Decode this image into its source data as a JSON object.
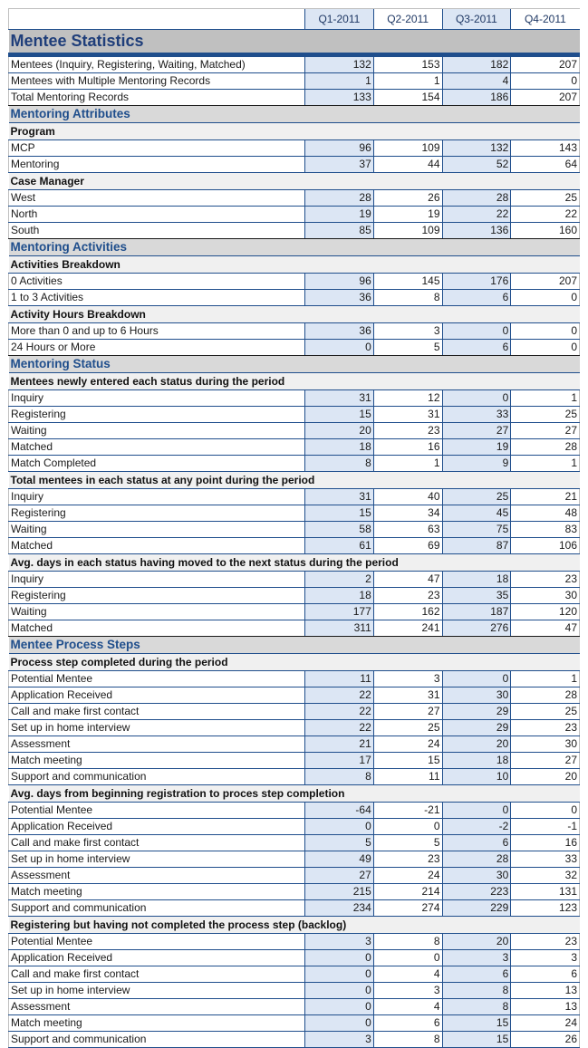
{
  "columns": [
    "Q1-2011",
    "Q2-2011",
    "Q3-2011",
    "Q4-2011"
  ],
  "title": "Mentee Statistics",
  "colors": {
    "title_text": "#1f3e7a",
    "accent_rule": "#1f4e8c",
    "shaded_column": "#dce6f4",
    "title_band": "#c0c0c0",
    "section_band": "#d9d9d9",
    "group_band": "#f0f0f0"
  },
  "top_rows": [
    {
      "label": "Mentees (Inquiry, Registering, Waiting, Matched)",
      "values": [
        132,
        153,
        182,
        207
      ]
    },
    {
      "label": "Mentees with Multiple Mentoring Records",
      "values": [
        1,
        1,
        4,
        0
      ]
    },
    {
      "label": "Total Mentoring Records",
      "values": [
        133,
        154,
        186,
        207
      ]
    }
  ],
  "sections": [
    {
      "title": "Mentoring Attributes",
      "groups": [
        {
          "title": "Program",
          "rows": [
            {
              "label": "MCP",
              "values": [
                96,
                109,
                132,
                143
              ]
            },
            {
              "label": "Mentoring",
              "values": [
                37,
                44,
                52,
                64
              ]
            }
          ]
        },
        {
          "title": "Case Manager",
          "rows": [
            {
              "label": "West",
              "values": [
                28,
                26,
                28,
                25
              ]
            },
            {
              "label": "North",
              "values": [
                19,
                19,
                22,
                22
              ]
            },
            {
              "label": "South",
              "values": [
                85,
                109,
                136,
                160
              ]
            }
          ]
        }
      ]
    },
    {
      "title": "Mentoring Activities",
      "groups": [
        {
          "title": "Activities Breakdown",
          "rows": [
            {
              "label": "0 Activities",
              "values": [
                96,
                145,
                176,
                207
              ]
            },
            {
              "label": "1 to 3 Activities",
              "values": [
                36,
                8,
                6,
                0
              ]
            }
          ]
        },
        {
          "title": "Activity Hours Breakdown",
          "rows": [
            {
              "label": "More than 0 and up to 6 Hours",
              "values": [
                36,
                3,
                0,
                0
              ]
            },
            {
              "label": "24 Hours or More",
              "values": [
                0,
                5,
                6,
                0
              ]
            }
          ]
        }
      ]
    },
    {
      "title": "Mentoring Status",
      "groups": [
        {
          "title": "Mentees newly entered each status during the period",
          "rows": [
            {
              "label": "Inquiry",
              "values": [
                31,
                12,
                0,
                1
              ]
            },
            {
              "label": "Registering",
              "values": [
                15,
                31,
                33,
                25
              ]
            },
            {
              "label": "Waiting",
              "values": [
                20,
                23,
                27,
                27
              ]
            },
            {
              "label": "Matched",
              "values": [
                18,
                16,
                19,
                28
              ]
            },
            {
              "label": "Match Completed",
              "values": [
                8,
                1,
                9,
                1
              ]
            }
          ]
        },
        {
          "title": "Total mentees in each status at any point during the period",
          "rows": [
            {
              "label": "Inquiry",
              "values": [
                31,
                40,
                25,
                21
              ]
            },
            {
              "label": "Registering",
              "values": [
                15,
                34,
                45,
                48
              ]
            },
            {
              "label": "Waiting",
              "values": [
                58,
                63,
                75,
                83
              ]
            },
            {
              "label": "Matched",
              "values": [
                61,
                69,
                87,
                106
              ]
            }
          ]
        },
        {
          "title": "Avg. days in each status having moved to the next status during the period",
          "rows": [
            {
              "label": "Inquiry",
              "values": [
                2,
                47,
                18,
                23
              ]
            },
            {
              "label": "Registering",
              "values": [
                18,
                23,
                35,
                30
              ]
            },
            {
              "label": "Waiting",
              "values": [
                177,
                162,
                187,
                120
              ]
            },
            {
              "label": "Matched",
              "values": [
                311,
                241,
                276,
                47
              ]
            }
          ]
        }
      ]
    },
    {
      "title": "Mentee Process Steps",
      "groups": [
        {
          "title": "Process step completed during the period",
          "rows": [
            {
              "label": "Potential Mentee",
              "values": [
                11,
                3,
                0,
                1
              ]
            },
            {
              "label": "Application Received",
              "values": [
                22,
                31,
                30,
                28
              ]
            },
            {
              "label": "Call and make first contact",
              "values": [
                22,
                27,
                29,
                25
              ]
            },
            {
              "label": "Set up in home interview",
              "values": [
                22,
                25,
                29,
                23
              ]
            },
            {
              "label": "Assessment",
              "values": [
                21,
                24,
                20,
                30
              ]
            },
            {
              "label": "Match meeting",
              "values": [
                17,
                15,
                18,
                27
              ]
            },
            {
              "label": "Support and communication",
              "values": [
                8,
                11,
                10,
                20
              ]
            }
          ]
        },
        {
          "title": "Avg. days from beginning registration to proces step completion",
          "rows": [
            {
              "label": "Potential Mentee",
              "values": [
                -64,
                -21,
                0,
                0
              ]
            },
            {
              "label": "Application Received",
              "values": [
                0,
                0,
                -2,
                -1
              ]
            },
            {
              "label": "Call and make first contact",
              "values": [
                5,
                5,
                6,
                16
              ]
            },
            {
              "label": "Set up in home interview",
              "values": [
                49,
                23,
                28,
                33
              ]
            },
            {
              "label": "Assessment",
              "values": [
                27,
                24,
                30,
                32
              ]
            },
            {
              "label": "Match meeting",
              "values": [
                215,
                214,
                223,
                131
              ]
            },
            {
              "label": "Support and communication",
              "values": [
                234,
                274,
                229,
                123
              ]
            }
          ]
        },
        {
          "title": "Registering but having not completed the process step (backlog)",
          "rows": [
            {
              "label": "Potential Mentee",
              "values": [
                3,
                8,
                20,
                23
              ]
            },
            {
              "label": "Application Received",
              "values": [
                0,
                0,
                3,
                3
              ]
            },
            {
              "label": "Call and make first contact",
              "values": [
                0,
                4,
                6,
                6
              ]
            },
            {
              "label": "Set up in home interview",
              "values": [
                0,
                3,
                8,
                13
              ]
            },
            {
              "label": "Assessment",
              "values": [
                0,
                4,
                8,
                13
              ]
            },
            {
              "label": "Match meeting",
              "values": [
                0,
                6,
                15,
                24
              ]
            },
            {
              "label": "Support and communication",
              "values": [
                3,
                8,
                15,
                26
              ]
            }
          ]
        }
      ]
    }
  ]
}
